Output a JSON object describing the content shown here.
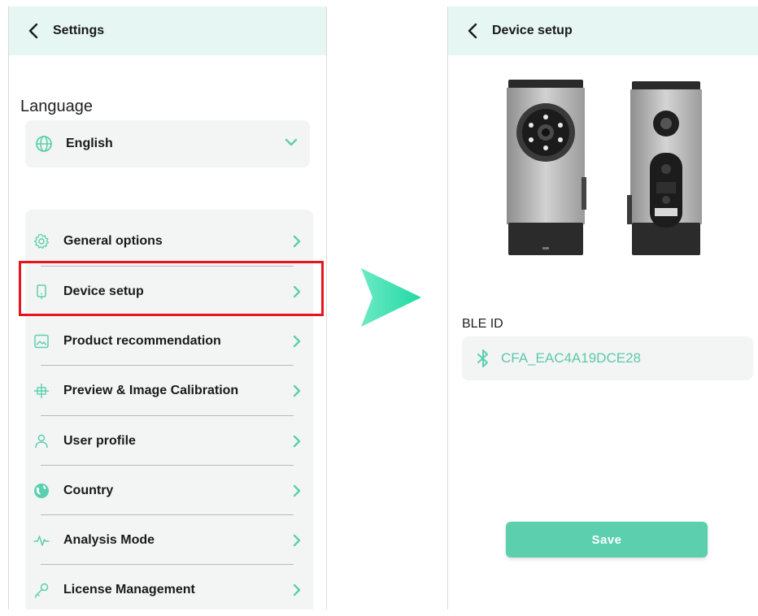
{
  "colors": {
    "accent": "#5ccfae",
    "header_bg": "#e6f6f2",
    "highlight": "#e8141b",
    "chevron": "#5ccfae"
  },
  "settings_screen": {
    "title": "Settings",
    "language": {
      "label": "Language",
      "value": "English",
      "icon": "globe-icon"
    },
    "menu": [
      {
        "label": "General options",
        "icon": "gear-icon"
      },
      {
        "label": "Device setup",
        "icon": "device-icon",
        "highlighted": true
      },
      {
        "label": "Product recommendation",
        "icon": "image-icon"
      },
      {
        "label": "Preview & Image Calibration",
        "icon": "crosshair-icon"
      },
      {
        "label": "User profile",
        "icon": "user-icon"
      },
      {
        "label": "Country",
        "icon": "earth-icon"
      },
      {
        "label": "Analysis Mode",
        "icon": "pulse-icon"
      },
      {
        "label": "License Management",
        "icon": "key-icon"
      }
    ]
  },
  "device_setup_screen": {
    "title": "Device setup",
    "ble_label": "BLE ID",
    "ble_value": "CFA_EAC4A19DCE28",
    "save_label": "Save"
  }
}
